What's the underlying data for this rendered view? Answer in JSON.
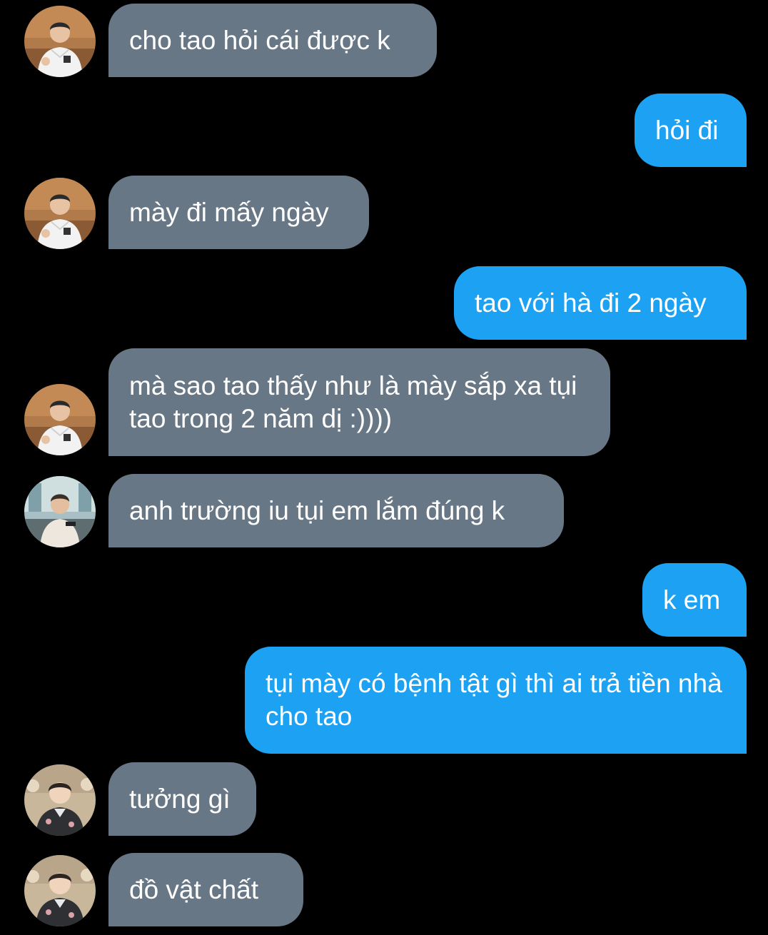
{
  "conversation": {
    "messages": [
      {
        "direction": "incoming",
        "avatar": "user-photo-white-hoodie-icon",
        "text": "cho tao hỏi cái được k"
      },
      {
        "direction": "outgoing",
        "text": "hỏi đi"
      },
      {
        "direction": "incoming",
        "avatar": "user-photo-white-hoodie-icon",
        "text": "mày đi mấy ngày"
      },
      {
        "direction": "outgoing",
        "text": "tao với hà đi 2 ngày"
      },
      {
        "direction": "incoming",
        "avatar": "user-photo-white-hoodie-icon",
        "text": "mà sao tao thấy như là mày sắp xa tụi tao trong 2 năm dị :))))"
      },
      {
        "direction": "incoming",
        "avatar": "user-photo-window-icon",
        "text": "anh trường iu tụi em lắm đúng k"
      },
      {
        "direction": "outgoing",
        "text": "k em"
      },
      {
        "direction": "outgoing",
        "text": "tụi mày có bệnh tật gì thì ai trả tiền nhà cho tao"
      },
      {
        "direction": "incoming",
        "avatar": "user-photo-flowers-icon",
        "text": "tưởng gì"
      },
      {
        "direction": "incoming",
        "avatar": "user-photo-flowers-icon",
        "text": "đồ vật chất"
      }
    ]
  },
  "colors": {
    "background": "#000000",
    "incoming_bubble": "#687786",
    "outgoing_bubble": "#1da1f2",
    "text": "#ffffff"
  }
}
